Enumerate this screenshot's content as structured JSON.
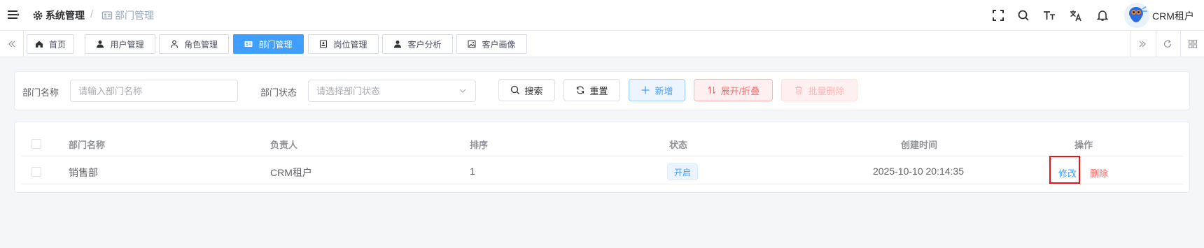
{
  "header": {
    "breadcrumb_root": "系统管理",
    "breadcrumb_current": "部门管理",
    "user_name": "CRM租户",
    "icons": [
      "menu-icon",
      "fullscreen-icon",
      "search-icon",
      "font-size-icon",
      "translate-icon",
      "bell-icon"
    ]
  },
  "tabs": [
    {
      "label": "首页",
      "icon": "home-icon"
    },
    {
      "label": "用户管理",
      "icon": "user-icon"
    },
    {
      "label": "角色管理",
      "icon": "user-outline-icon"
    },
    {
      "label": "部门管理",
      "icon": "id-card-icon",
      "active": true
    },
    {
      "label": "岗位管理",
      "icon": "badge-icon"
    },
    {
      "label": "客户分析",
      "icon": "user-icon"
    },
    {
      "label": "客户画像",
      "icon": "picture-icon"
    }
  ],
  "search": {
    "dept_name_label": "部门名称",
    "dept_name_placeholder": "请输入部门名称",
    "dept_status_label": "部门状态",
    "dept_status_placeholder": "请选择部门状态",
    "search_btn": "搜索",
    "reset_btn": "重置",
    "add_btn": "新增",
    "toggle_btn": "展开/折叠",
    "batch_delete_btn": "批量删除"
  },
  "table": {
    "columns": [
      "部门名称",
      "负责人",
      "排序",
      "状态",
      "创建时间",
      "操作"
    ],
    "rows": [
      {
        "name": "销售部",
        "leader": "CRM租户",
        "sort": "1",
        "status": "开启",
        "created": "2025-10-10 20:14:35",
        "edit": "修改",
        "delete": "删除"
      }
    ]
  },
  "colors": {
    "primary": "#409eff",
    "danger": "#f56c6c",
    "highlight": "#e6131a"
  }
}
